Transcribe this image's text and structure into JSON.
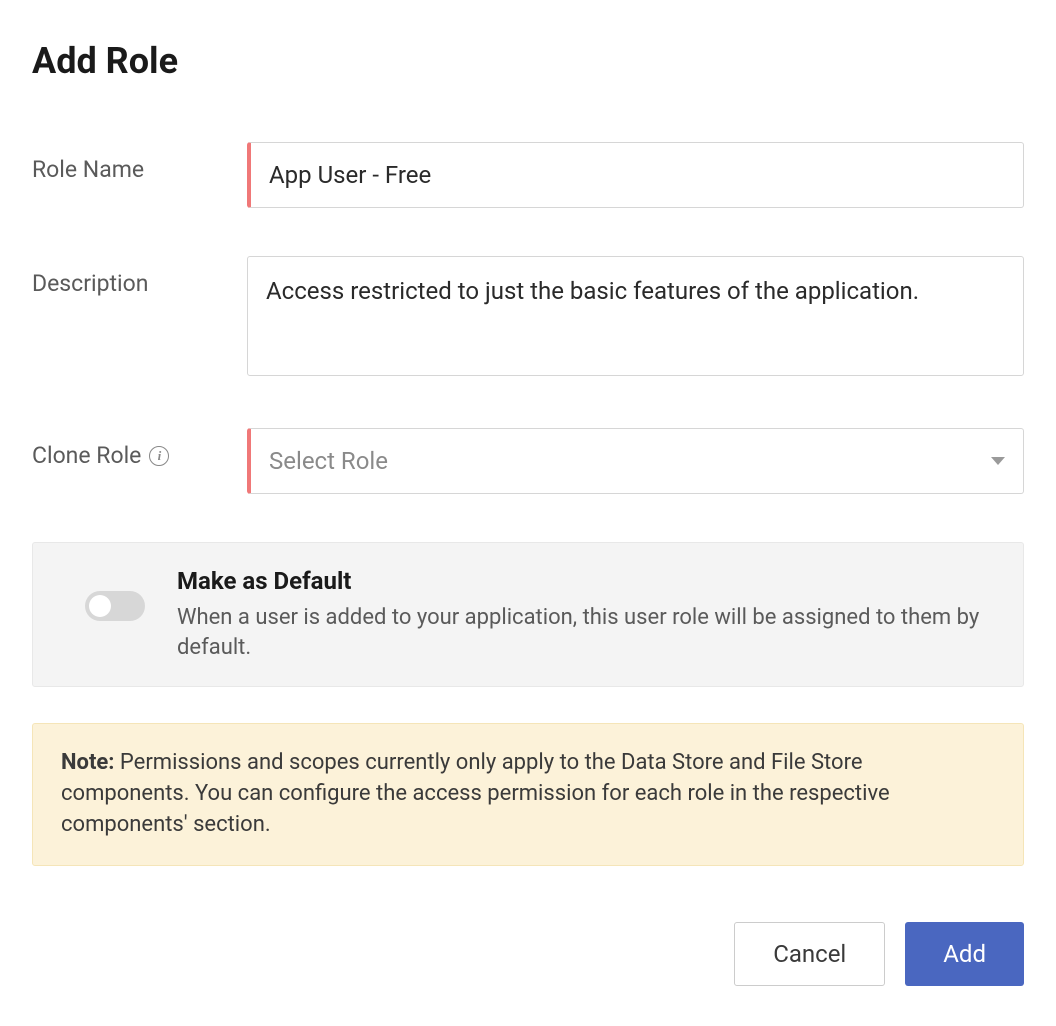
{
  "page": {
    "title": "Add Role"
  },
  "form": {
    "role_name": {
      "label": "Role Name",
      "value": "App User - Free"
    },
    "description": {
      "label": "Description",
      "value": "Access restricted to just the basic features of the application."
    },
    "clone_role": {
      "label": "Clone Role",
      "placeholder": "Select Role"
    }
  },
  "default_panel": {
    "title": "Make as Default",
    "description": "When a user is added to your application, this user role will be assigned to them by default."
  },
  "note": {
    "label": "Note:",
    "text": " Permissions and scopes currently only apply to the Data Store and File Store components. You can configure the access permission for each role in the respective components' section."
  },
  "buttons": {
    "cancel": "Cancel",
    "add": "Add"
  }
}
